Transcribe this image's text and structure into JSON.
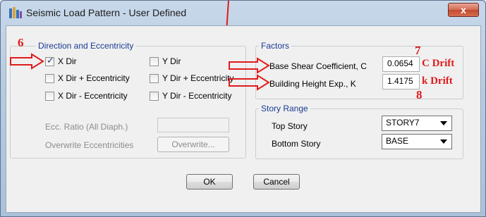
{
  "window": {
    "title": "Seismic Load Pattern - User Defined",
    "close_label": "x"
  },
  "direction_group": {
    "title": "Direction and Eccentricity",
    "options": [
      {
        "label": "X Dir",
        "checked": true
      },
      {
        "label": "X Dir + Eccentricity",
        "checked": false
      },
      {
        "label": "X Dir - Eccentricity",
        "checked": false
      },
      {
        "label": "Y Dir",
        "checked": false
      },
      {
        "label": "Y Dir + Eccentricity",
        "checked": false
      },
      {
        "label": "Y Dir - Eccentricity",
        "checked": false
      }
    ],
    "ecc_ratio_label": "Ecc. Ratio (All Diaph.)",
    "ecc_ratio_value": "",
    "overwrite_label": "Overwrite Eccentricities",
    "overwrite_button": "Overwrite..."
  },
  "factors_group": {
    "title": "Factors",
    "base_shear_label": "Base Shear Coefficient, C",
    "base_shear_value": "0.0654",
    "height_exp_label": "Building Height Exp., K",
    "height_exp_value": "1.4175"
  },
  "story_range_group": {
    "title": "Story Range",
    "top_story_label": "Top Story",
    "top_story_value": "STORY7",
    "bottom_story_label": "Bottom Story",
    "bottom_story_value": "BASE"
  },
  "buttons": {
    "ok": "OK",
    "cancel": "Cancel"
  },
  "annotations": {
    "num_6": "6",
    "num_7": "7",
    "num_8": "8",
    "c_drift": "C Drift",
    "k_drift": "k Drift",
    "color": "#e01b1b"
  }
}
